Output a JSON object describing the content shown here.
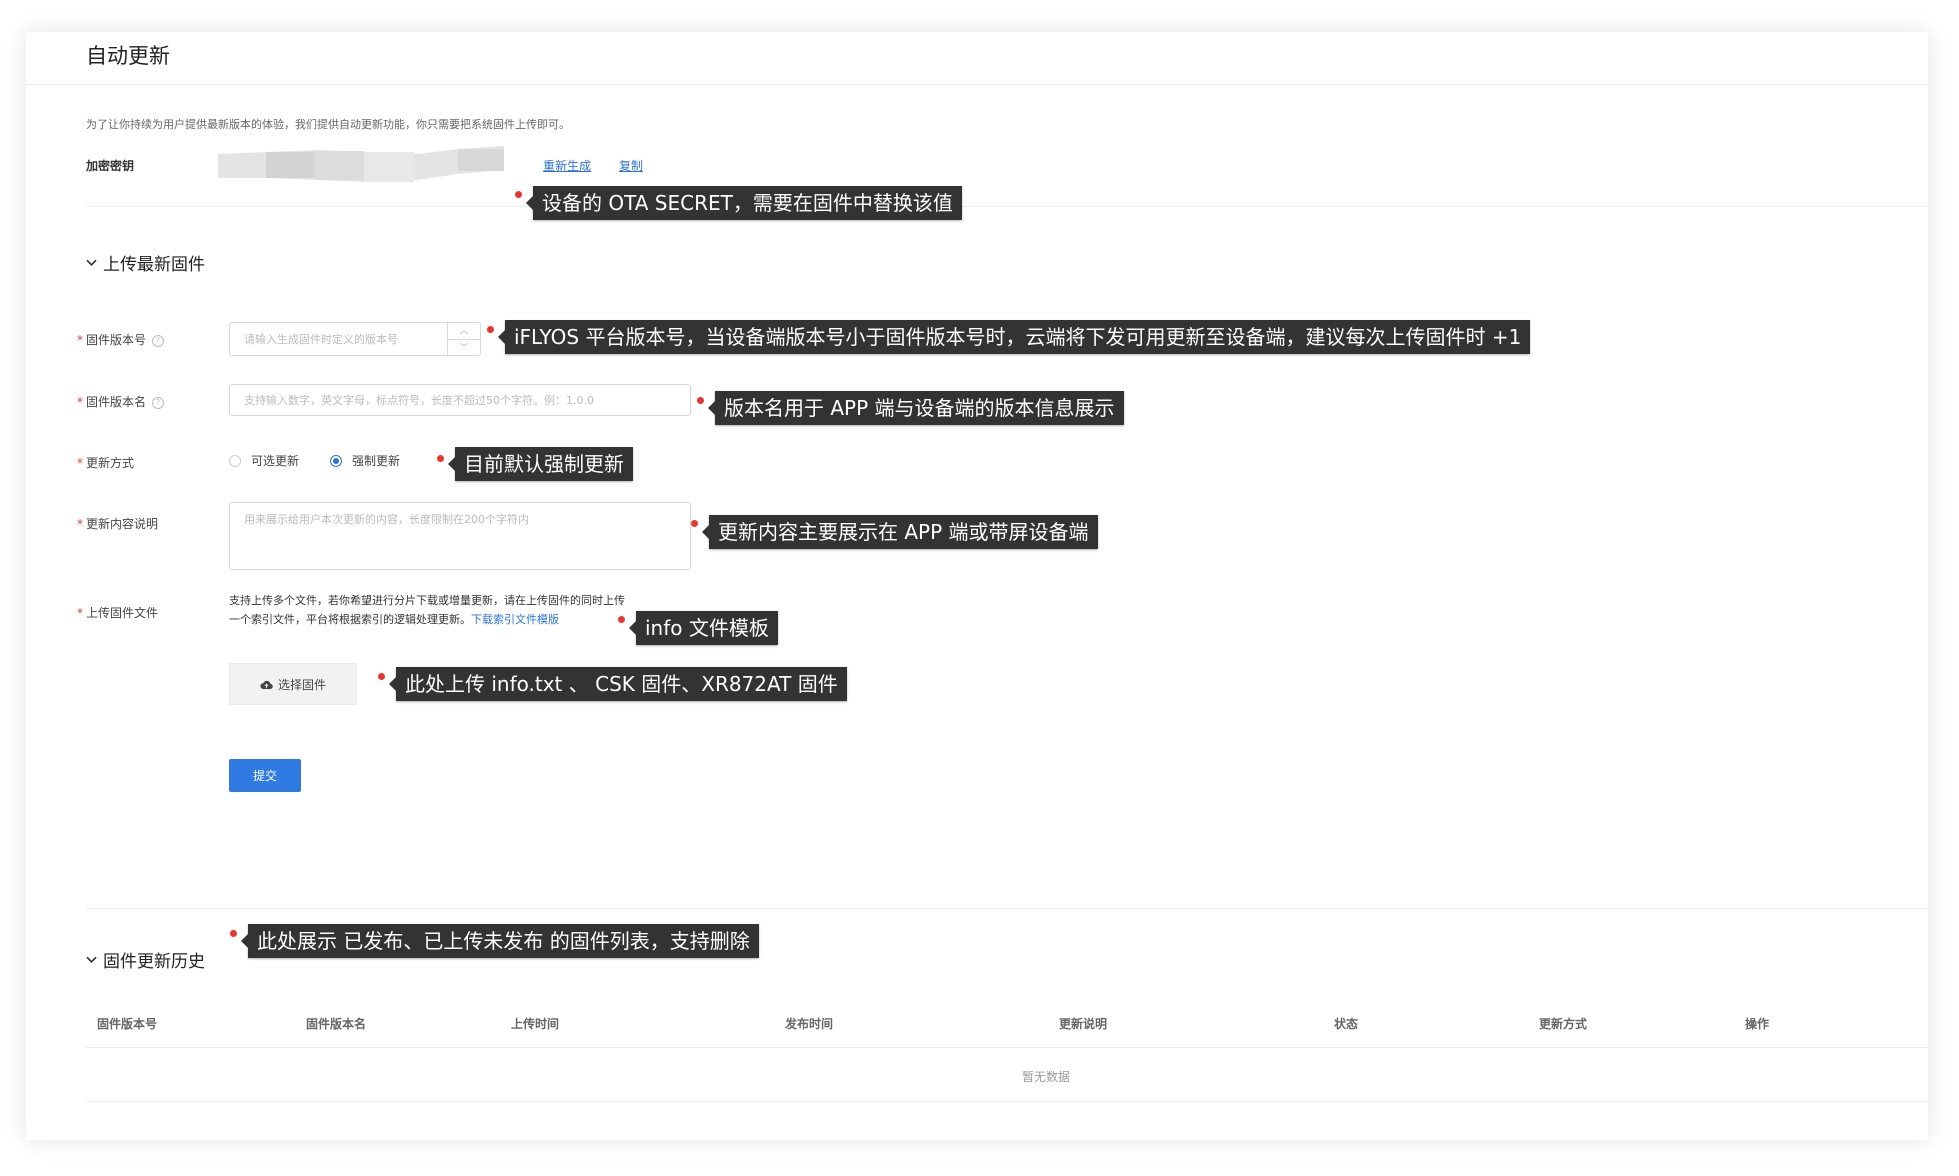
{
  "page": {
    "title": "自动更新"
  },
  "intro": "为了让你持续为用户提供最新版本的体验，我们提供自动更新功能，你只需要把系统固件上传即可。",
  "secret": {
    "label": "加密密钥",
    "regenerate": "重新生成",
    "copy": "复制"
  },
  "upload_section": {
    "title": "上传最新固件",
    "fields": {
      "version_code": {
        "label": "固件版本号",
        "placeholder": "请输入生成固件时定义的版本号"
      },
      "version_name": {
        "label": "固件版本名",
        "placeholder": "支持输入数字，英文字母，标点符号，长度不超过50个字符。例：1.0.0"
      },
      "update_mode": {
        "label": "更新方式",
        "options": [
          "可选更新",
          "强制更新"
        ],
        "selected": "强制更新"
      },
      "description": {
        "label": "更新内容说明",
        "placeholder": "用来展示给用户本次更新的内容，长度限制在200个字符内"
      },
      "file": {
        "label": "上传固件文件",
        "hint_line1": "支持上传多个文件，若你希望进行分片下载或增量更新，请在上传固件的同时上传",
        "hint_line2": "一个索引文件，平台将根据索引的逻辑处理更新。",
        "template_link": "下载索引文件模版",
        "button": "选择固件"
      }
    },
    "submit": "提交"
  },
  "history_section": {
    "title": "固件更新历史",
    "columns": [
      "固件版本号",
      "固件版本名",
      "上传时间",
      "发布时间",
      "更新说明",
      "状态",
      "更新方式",
      "操作"
    ],
    "empty_text": "暂无数据"
  },
  "annotations": {
    "secret": "设备的 OTA SECRET，需要在固件中替换该值",
    "version_code": "iFLYOS 平台版本号，当设备端版本号小于固件版本号时，云端将下发可用更新至设备端，建议每次上传固件时 +1",
    "version_name": "版本名用于 APP 端与设备端的版本信息展示",
    "update_mode": "目前默认强制更新",
    "description": "更新内容主要展示在 APP 端或带屏设备端",
    "template": "info 文件模板",
    "upload": "此处上传 info.txt 、 CSK 固件、XR872AT 固件",
    "history": "此处展示 已发布、已上传未发布 的固件列表，支持删除"
  },
  "colors": {
    "accent": "#2f7be1",
    "required": "#e23a3a",
    "annotation_bg": "#333333",
    "annotation_pin": "#e8352e"
  }
}
